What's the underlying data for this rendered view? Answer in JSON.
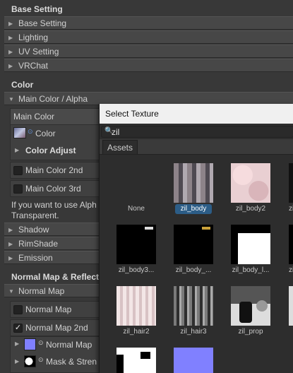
{
  "sections": {
    "base_setting": "Base Setting",
    "color": "Color",
    "normal_map_reflect": "Normal Map & Reflect"
  },
  "foldouts": {
    "base_setting": "Base Setting",
    "lighting": "Lighting",
    "uv_setting": "UV Setting",
    "vrchat": "VRChat",
    "main_color_alpha": "Main Color / Alpha",
    "shadow": "Shadow",
    "rimshade": "RimShade",
    "emission": "Emission",
    "normal_map": "Normal Map"
  },
  "main_color": {
    "header": "Main Color",
    "color_label": "Color",
    "color_adjust": "Color Adjust",
    "main_color_2nd": "Main Color 2nd",
    "main_color_3rd": "Main Color 3rd",
    "help_text_line1": "If you want to use Alph",
    "help_text_line2": "Transparent."
  },
  "normal": {
    "normal_map_check": "Normal Map",
    "normal_map_2nd_check": "Normal Map 2nd",
    "normal_map_tex": "Normal Map",
    "mask_strength": "Mask & Stren"
  },
  "dialog": {
    "title": "Select Texture",
    "search_value": "zil",
    "tab_assets": "Assets",
    "items": [
      {
        "label": "None"
      },
      {
        "label": "zil_body",
        "selected": true
      },
      {
        "label": "zil_body2"
      },
      {
        "label": "zi"
      },
      {
        "label": "zil_body3..."
      },
      {
        "label": "zil_body_..."
      },
      {
        "label": "zil_body_l..."
      },
      {
        "label": "zi"
      },
      {
        "label": "zil_hair2"
      },
      {
        "label": "zil_hair3"
      },
      {
        "label": "zil_prop"
      },
      {
        "label": ""
      }
    ]
  },
  "colors": {
    "background": "#383838",
    "selection": "#2c5d87",
    "dialog_title_bg": "#f0f0f0"
  }
}
